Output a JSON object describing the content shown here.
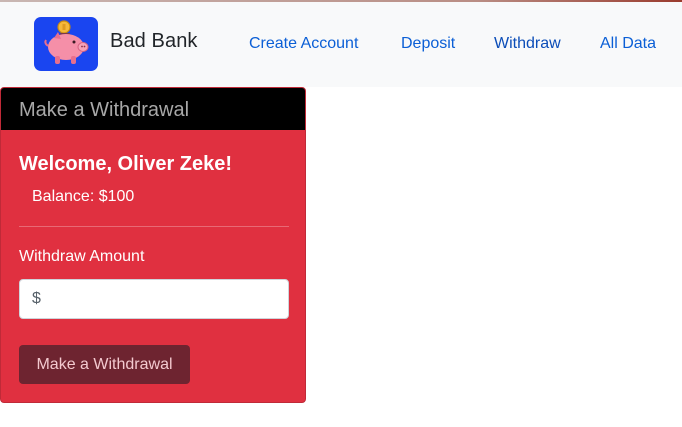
{
  "navbar": {
    "brand": "Bad Bank",
    "logo_icon": "piggy-bank-icon",
    "links": [
      {
        "label": "Create Account"
      },
      {
        "label": "Deposit"
      },
      {
        "label": "Withdraw"
      },
      {
        "label": "All Data"
      }
    ]
  },
  "card": {
    "header": "Make a Withdrawal",
    "welcome": "Welcome, Oliver Zeke!",
    "balance": "Balance: $100",
    "field_label": "Withdraw Amount",
    "input_placeholder": "$",
    "input_value": "",
    "button_label": "Make a Withdrawal"
  },
  "colors": {
    "card_bg": "#e03040",
    "card_header_bg": "#000000",
    "button_bg": "#6e2430",
    "link": "#0b5fd6",
    "navbar_bg": "#f8f9fa"
  }
}
